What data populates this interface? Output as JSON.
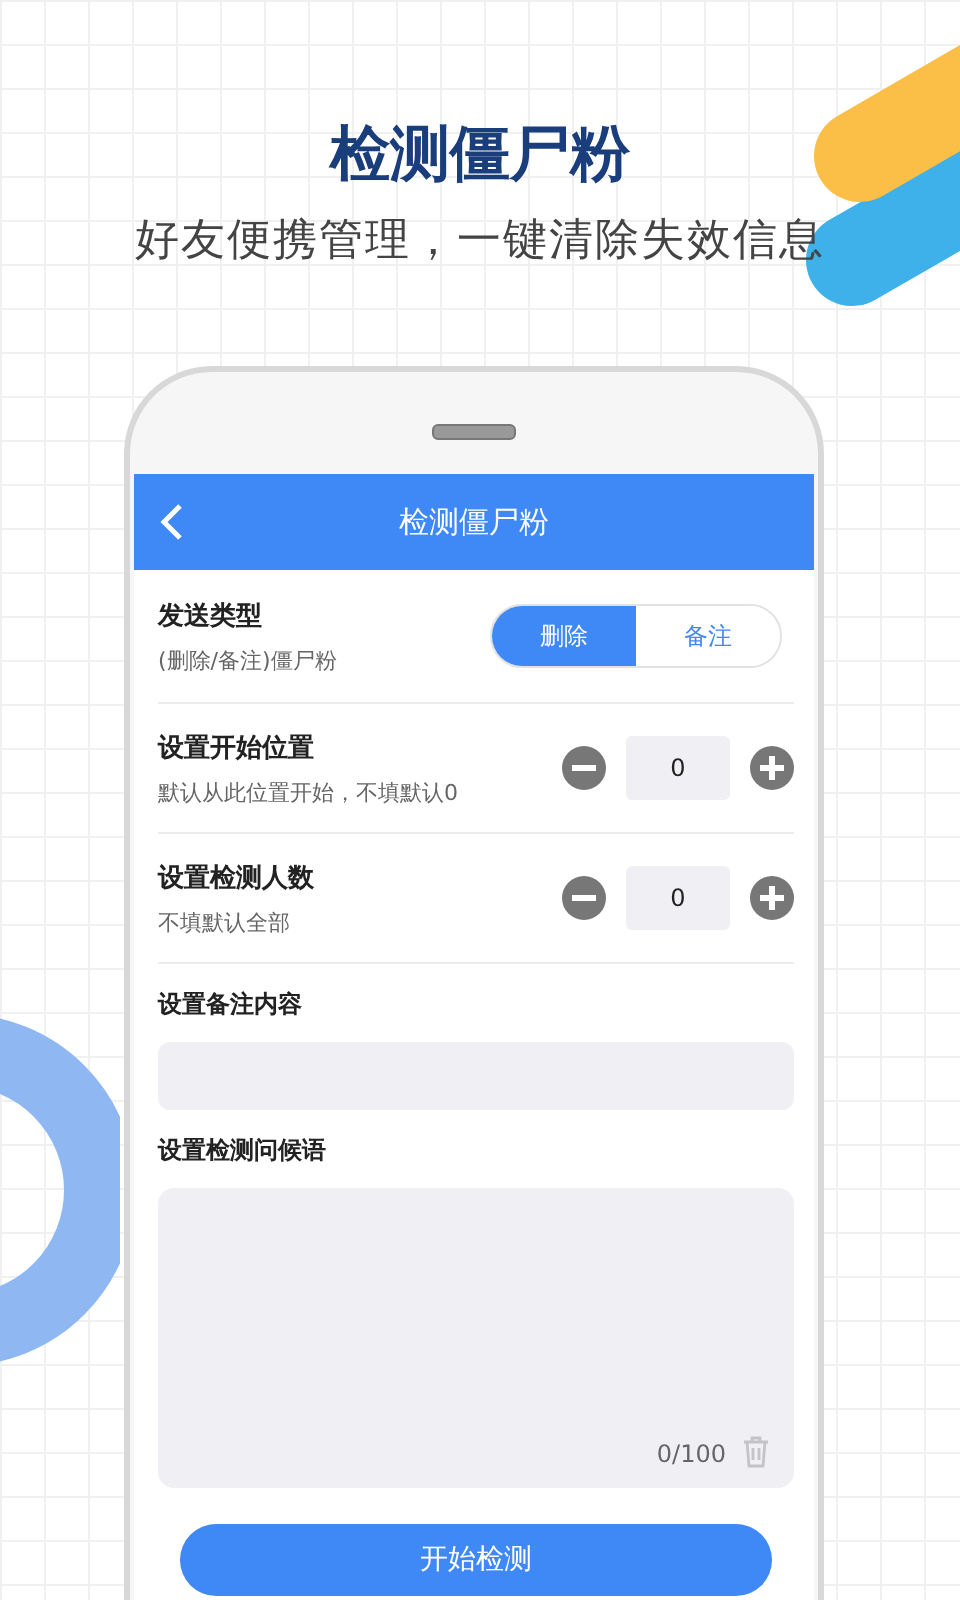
{
  "promo": {
    "headline": "检测僵尸粉",
    "tagline": "好友便携管理，一键清除失效信息"
  },
  "app_bar": {
    "title": "检测僵尸粉"
  },
  "send_type": {
    "label": "发送类型",
    "hint": "(删除/备注)僵尸粉",
    "options": [
      {
        "label": "删除",
        "selected": true
      },
      {
        "label": "备注",
        "selected": false
      }
    ]
  },
  "steppers": [
    {
      "label": "设置开始位置",
      "hint": "默认从此位置开始，不填默认0",
      "value": "0"
    },
    {
      "label": "设置检测人数",
      "hint": "不填默认全部",
      "value": "0"
    }
  ],
  "remark": {
    "label": "设置备注内容"
  },
  "greeting": {
    "label": "设置检测问候语",
    "counter": "0/100"
  },
  "start_button": "开始检测"
}
